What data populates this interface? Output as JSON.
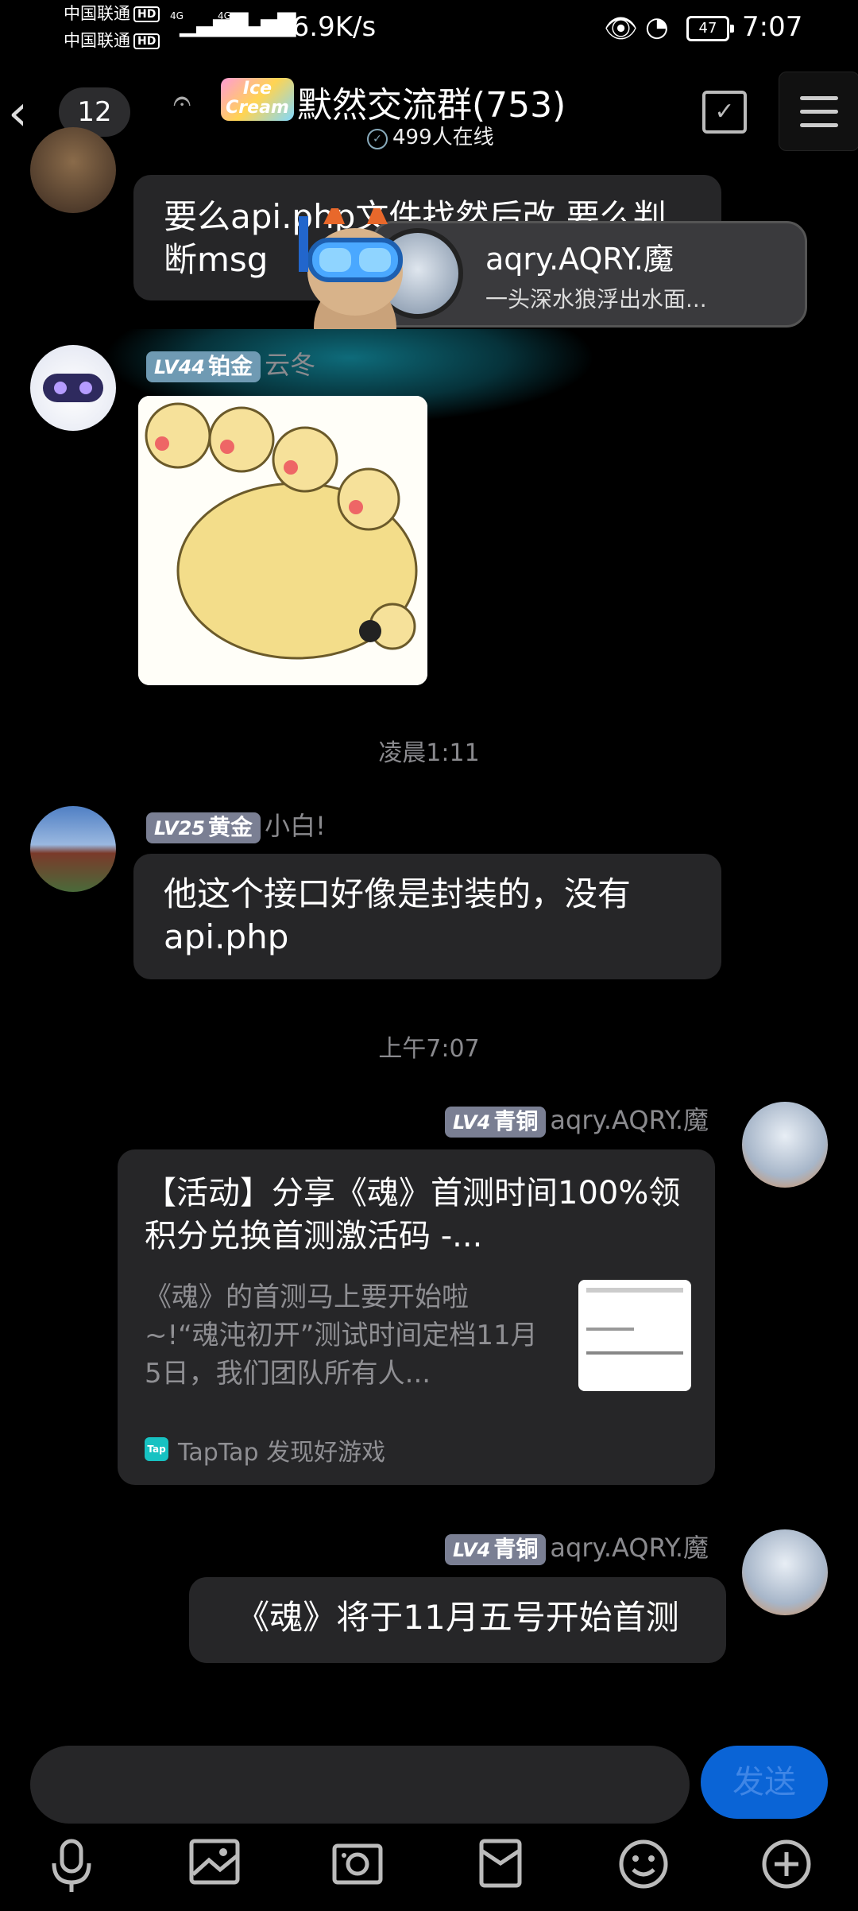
{
  "status_bar": {
    "carrier1": "中国联通",
    "carrier2": "中国联通",
    "hd": "HD",
    "net1": "4G",
    "net2": "4G",
    "speed": "66.9K/s",
    "battery": "47",
    "time": "7:07"
  },
  "header": {
    "back_icon": "chevron-left",
    "unread_count": "12",
    "logo_text": "Ice Cream",
    "title": "默然交流群(753)",
    "online": "499人在线"
  },
  "messages": [
    {
      "type": "text",
      "text": "要么api.php文件找然后改,要么判断msg"
    },
    {
      "type": "image",
      "level": "LV44",
      "rank": "铂金",
      "nick": "云冬"
    },
    {
      "type": "time",
      "text": "凌晨1:11"
    },
    {
      "type": "text",
      "level": "LV25",
      "rank": "黄金",
      "nick": "小白!",
      "text": "他这个接口好像是封装的，没有api.php"
    },
    {
      "type": "time",
      "text": "上午7:07"
    },
    {
      "type": "card",
      "level": "LV4",
      "rank": "青铜",
      "nick": "aqry.AQRY.魔",
      "card_title": "【活动】分享《魂》首测时间100%领积分兑换首测激活码 -...",
      "card_desc": "《魂》的首测马上要开始啦~!“魂沌初开”测试时间定档11月5日，我们团队所有人...",
      "card_source": "TapTap 发现好游戏",
      "source_icon": "Tap"
    },
    {
      "type": "text",
      "level": "LV4",
      "rank": "青铜",
      "nick": "aqry.AQRY.魔",
      "text": "《魂》将于11月五号开始首测"
    }
  ],
  "notification": {
    "name": "aqry.AQRY.魔",
    "text": "一头深水狼浮出水面..."
  },
  "input": {
    "send_label": "发送"
  },
  "toolbar": [
    "mic-icon",
    "image-icon",
    "camera-icon",
    "red-packet-icon",
    "emoji-icon",
    "plus-icon"
  ]
}
